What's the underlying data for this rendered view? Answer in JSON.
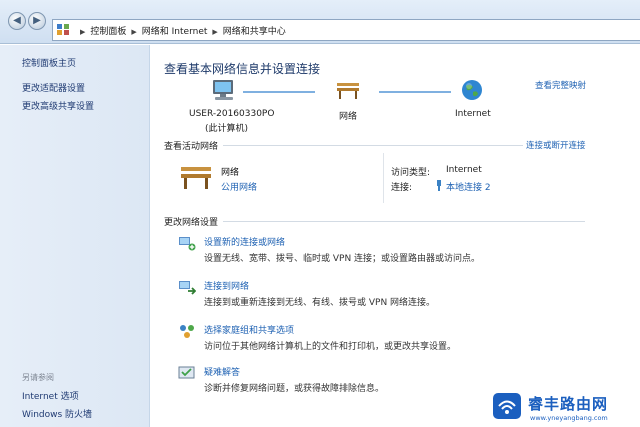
{
  "address_bar": {
    "crumbs": [
      "控制面板",
      "网络和 Internet",
      "网络和共享中心"
    ]
  },
  "left_pane": {
    "home": "控制面板主页",
    "adapter_settings": "更改适配器设置",
    "advanced_sharing": "更改高级共享设置",
    "see_also_title": "另请参阅",
    "internet_options": "Internet 选项",
    "firewall": "Windows 防火墙"
  },
  "main": {
    "title": "查看基本网络信息并设置连接",
    "full_map_link": "查看完整映射",
    "map": {
      "computer_name": "USER-20160330PO",
      "computer_sub": "(此计算机)",
      "network": "网络",
      "internet": "Internet"
    },
    "active_networks": {
      "heading": "查看活动网络",
      "connect_link": "连接或断开连接",
      "network_name": "网络",
      "network_type": "公用网络",
      "access_type_label": "访问类型:",
      "access_type_value": "Internet",
      "connections_label": "连接:",
      "connections_value": "本地连接 2"
    },
    "change_settings": {
      "heading": "更改网络设置",
      "tasks": [
        {
          "title": "设置新的连接或网络",
          "desc": "设置无线、宽带、拨号、临时或 VPN 连接；或设置路由器或访问点。"
        },
        {
          "title": "连接到网络",
          "desc": "连接到或重新连接到无线、有线、拨号或 VPN 网络连接。"
        },
        {
          "title": "选择家庭组和共享选项",
          "desc": "访问位于其他网络计算机上的文件和打印机，或更改共享设置。"
        },
        {
          "title": "疑难解答",
          "desc": "诊断并修复网络问题，或获得故障排除信息。"
        }
      ]
    }
  },
  "watermark": {
    "text": "睿丰路由网",
    "url": "www.yneyangbang.com"
  },
  "colors": {
    "link": "#1f62b3",
    "title": "#1e3a6a",
    "left_pane_bg": "#e0eaf6",
    "map_line": "#7fb0e0"
  }
}
